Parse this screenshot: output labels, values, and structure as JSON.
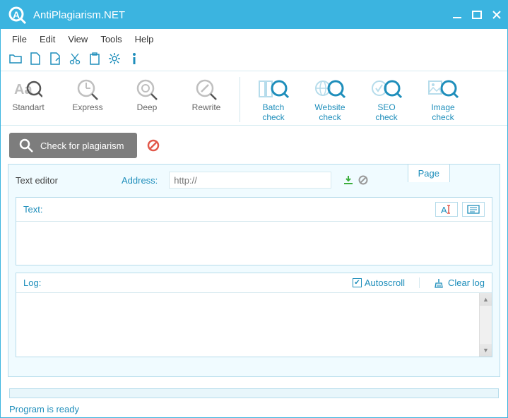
{
  "titlebar": {
    "title": "AntiPlagiarism.NET"
  },
  "menubar": [
    "File",
    "Edit",
    "View",
    "Tools",
    "Help"
  ],
  "ribbon": {
    "left": [
      "Standart",
      "Express",
      "Deep",
      "Rewrite"
    ],
    "right": [
      "Batch\ncheck",
      "Website\ncheck",
      "SEO\ncheck",
      "Image\ncheck"
    ]
  },
  "actions": {
    "check": "Check for plagiarism"
  },
  "editor": {
    "label": "Text editor",
    "address_label": "Address:",
    "address_placeholder": "http://",
    "page_tab": "Page"
  },
  "text_panel": {
    "label": "Text:"
  },
  "log_panel": {
    "label": "Log:",
    "autoscroll": "Autoscroll",
    "clear": "Clear log"
  },
  "status": {
    "text": "Program is ready"
  }
}
